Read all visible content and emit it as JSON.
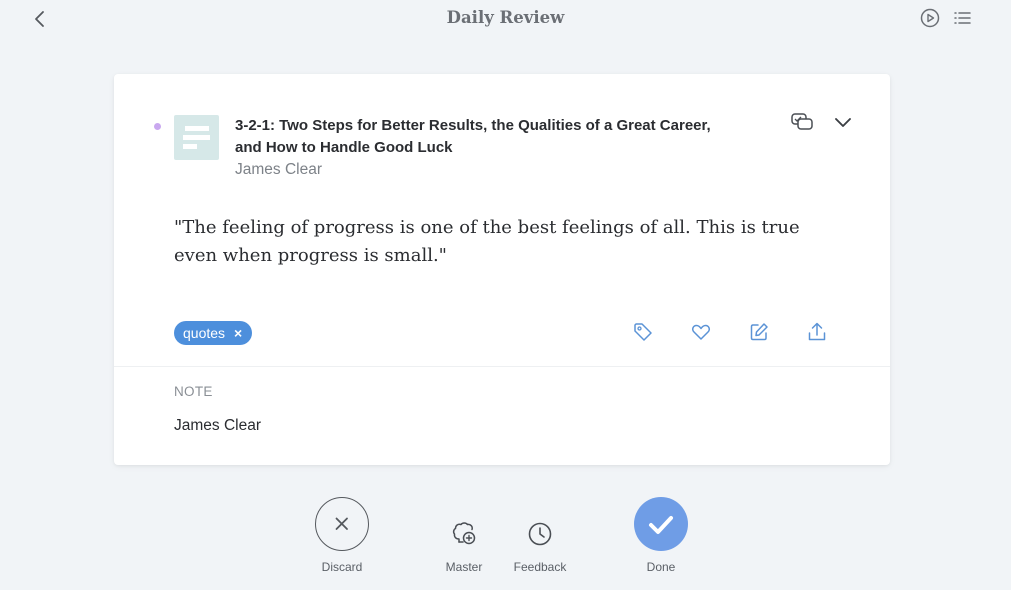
{
  "header": {
    "title": "Daily Review",
    "icons": [
      "chevron-left-icon",
      "play-circle-icon",
      "list-icon"
    ]
  },
  "highlight": {
    "document_title": "3-2-1: Two Steps for Better Results, the Qualities of a Great Career, and How to Handle Good Luck",
    "author": "James Clear",
    "quote": "\"The feeling of progress is one of the best feelings of all. This is true even when progress is small.\"",
    "tags": [
      {
        "label": "quotes",
        "remove": "×"
      }
    ],
    "actions": [
      "tag-icon",
      "heart-icon",
      "edit-icon",
      "share-icon"
    ],
    "note": {
      "label": "NOTE",
      "text": "James Clear"
    }
  },
  "footer": {
    "discard": "Discard",
    "master": "Master",
    "feedback": "Feedback",
    "done": "Done"
  },
  "colors": {
    "background": "#f1f4f7",
    "card": "#ffffff",
    "tag": "#4d8fdc",
    "done": "#6f9de6",
    "unread_dot": "#c9a8ef",
    "thumbnail": "#d6e8e8",
    "icon_blue": "#5b93d6"
  }
}
